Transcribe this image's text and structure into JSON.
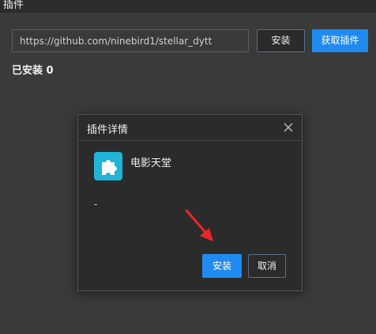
{
  "window": {
    "title": "插件"
  },
  "toolbar": {
    "url_value": "https://github.com/ninebird1/stellar_dytt",
    "install_label": "安装",
    "fetch_label": "获取插件"
  },
  "installed": {
    "text": "已安装 0"
  },
  "modal": {
    "title": "插件详情",
    "plugin_name": "电影天堂",
    "plugin_icon": "puzzle-icon",
    "description": "-",
    "install_label": "安装",
    "cancel_label": "取消"
  },
  "colors": {
    "background": "#3a3a3a",
    "primary": "#1f8bf0",
    "plugin_icon_bg": "#1fb4d8",
    "annotation_arrow": "#e8262b"
  }
}
